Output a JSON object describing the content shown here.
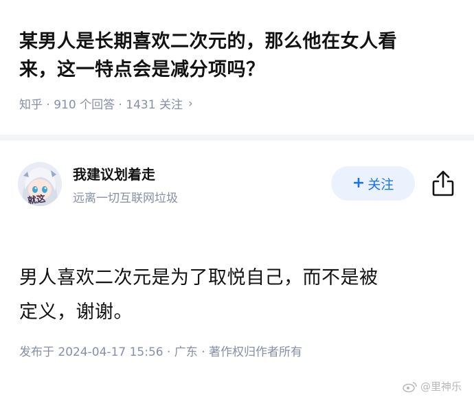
{
  "question": {
    "title_line1": "某男人是长期喜欢二次元的，那么他在女人看",
    "title_line2": "来，这一特点会是减分项吗？",
    "meta": "知乎 · 910 个回答 · 1431 关注",
    "chevron": "›"
  },
  "author": {
    "name": "我建议划着走",
    "bio": "远离一切互联网垃圾",
    "avatar_text": "就这",
    "follow_label": "关注",
    "follow_plus": "+"
  },
  "answer": {
    "line1": "男人喜欢二次元是为了取悦自己，而不是被",
    "line2": "定义，谢谢。",
    "meta": "发布于 2024-04-17 15:56 · 广东 · 著作权归作者所有"
  },
  "watermark": {
    "text": "@里神乐"
  },
  "colors": {
    "accent": "#1772f6",
    "meta_gray": "#8590a6",
    "follow_bg": "#ebf2fd"
  }
}
